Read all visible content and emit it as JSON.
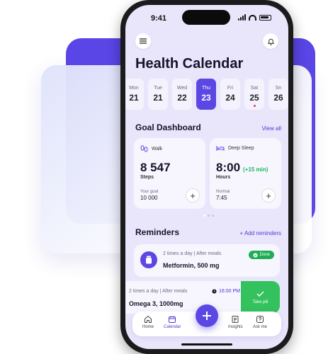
{
  "status": {
    "time": "9:41"
  },
  "header": {
    "title": "Health Calendar"
  },
  "days": [
    {
      "name": "Mon",
      "date": "21"
    },
    {
      "name": "Tue",
      "date": "21"
    },
    {
      "name": "Wed",
      "date": "22"
    },
    {
      "name": "Thu",
      "date": "23",
      "active": true
    },
    {
      "name": "Fri",
      "date": "24"
    },
    {
      "name": "Sat",
      "date": "25",
      "dot": true
    },
    {
      "name": "Sn",
      "date": "26"
    }
  ],
  "goal": {
    "title": "Goal Dashboard",
    "view_all": "View all",
    "walk": {
      "label": "Walk",
      "value": "8 547",
      "unit": "Steps",
      "goal_label": "Your goal",
      "goal_value": "10 000"
    },
    "sleep": {
      "label": "Deep Sleep",
      "value": "8:00",
      "delta": "(+15 min)",
      "unit": "Hours",
      "goal_label": "Normal",
      "goal_value": "7:45"
    }
  },
  "reminders": {
    "title": "Reminders",
    "add": "+ Add reminders",
    "items": [
      {
        "meta": "2 times a day  |  After meals",
        "name": "Metformin, 500 mg",
        "status": "Done"
      },
      {
        "meta": "2 times a day  |  After meals",
        "name": "Omega 3, 1000mg",
        "time": "16:00 PM",
        "action": "Take pill"
      }
    ]
  },
  "tabs": {
    "home": "Home",
    "calendar": "Calendar",
    "insights": "Insights",
    "ask": "Ask me"
  },
  "colors": {
    "accent": "#5b47e4",
    "success": "#33c25e"
  }
}
